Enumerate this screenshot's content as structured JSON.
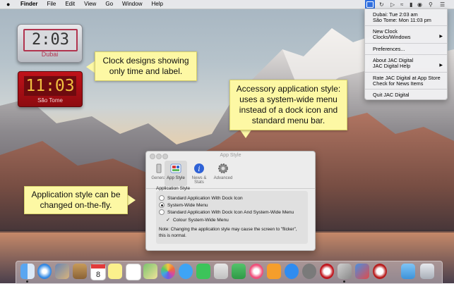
{
  "menubar": {
    "app_name": "Finder",
    "items": [
      "File",
      "Edit",
      "View",
      "Go",
      "Window",
      "Help"
    ]
  },
  "status_icons": [
    "jac-digital-icon",
    "time-machine-icon",
    "volume-icon",
    "wifi-icon",
    "battery-icon",
    "user-icon",
    "spotlight-icon",
    "notification-center-icon"
  ],
  "dropdown": {
    "times": [
      "Dubai: Tue 2:03 am",
      "São Tome: Mon 11:03 pm"
    ],
    "new_clock": "New Clock",
    "clocks_windows": "Clocks/Windows",
    "preferences": "Preferences...",
    "about": "About JAC Digital",
    "help": "JAC Digital Help",
    "rate": "Rate JAC Digital at App Store",
    "check_news": "Check for News Items",
    "quit": "Quit JAC Digital"
  },
  "clocks": [
    {
      "time": "2:03",
      "label": "Dubai"
    },
    {
      "time": "11:03",
      "label": "São Tome"
    }
  ],
  "callouts": {
    "clock_designs": "Clock designs showing only time and label.",
    "accessory": "Accessory application style: uses a system-wide menu instead of a dock icon and standard menu bar.",
    "style_change": "Application style can be changed on-the-fly."
  },
  "prefs": {
    "title": "App Style",
    "tabs": [
      "General",
      "App Style",
      "News & Stats",
      "Advanced"
    ],
    "section_title": "Application Style",
    "options": [
      "Standard Application With Dock Icon",
      "System-Wide Menu",
      "Standard Application With Dock Icon And System-Wide Menu"
    ],
    "selected_option": 1,
    "checkbox_label": "Colour System-Wide Menu",
    "checkbox_checked": true,
    "note": "Note: Changing the application style may cause the screen to \"flicker\", this is normal."
  },
  "dock": {
    "icons": [
      "finder-icon",
      "safari-icon",
      "photo-icon",
      "notes-icon",
      "calendar-icon",
      "stickies-icon",
      "reminders-icon",
      "maps-icon",
      "photos-icon",
      "messages-icon",
      "facetime-icon",
      "keynote-icon",
      "numbers-icon",
      "music-icon",
      "books-icon",
      "app-store-icon",
      "system-preferences-icon",
      "clock-app-icon",
      "jac-digital-dock-icon",
      "news-icon",
      "clocks-icon",
      "downloads-folder-icon",
      "trash-icon"
    ]
  }
}
